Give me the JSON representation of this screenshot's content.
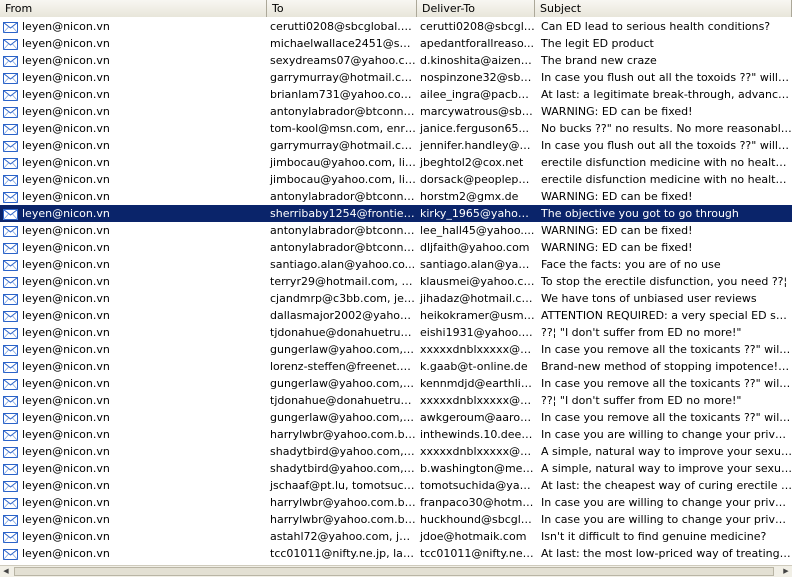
{
  "columns": {
    "from": "From",
    "to": "To",
    "deliver_to": "Deliver-To",
    "subject": "Subject"
  },
  "icon": "envelope-icon",
  "selected_index": 11,
  "rows": [
    {
      "from": "leyen@nicon.vn",
      "to": "cerutti0208@sbcglobal.ne...",
      "deliver_to": "cerutti0208@sbcglo...",
      "subject": "Can ED lead to serious health conditions?"
    },
    {
      "from": "leyen@nicon.vn",
      "to": "michaelwallace2451@sbcg...",
      "deliver_to": "apedantforallreaso...",
      "subject": "The legit ED product"
    },
    {
      "from": "leyen@nicon.vn",
      "to": "sexydreams07@yahoo.co...",
      "deliver_to": "d.kinoshita@aizene...",
      "subject": "The brand new craze"
    },
    {
      "from": "leyen@nicon.vn",
      "to": "garrymurray@hotmail.co...",
      "deliver_to": "nospinzone32@sbc...",
      "subject": "In case you flush out all the toxoids ??\" will it st..."
    },
    {
      "from": "leyen@nicon.vn",
      "to": "brianlam731@yahoo.com....",
      "deliver_to": "ailee_ingra@pacbell...",
      "subject": "At last: a legitimate break-through, advanced i..."
    },
    {
      "from": "leyen@nicon.vn",
      "to": "antonylabrador@btconne...",
      "deliver_to": "marcywatrous@sbc...",
      "subject": "WARNING: ED can be fixed!"
    },
    {
      "from": "leyen@nicon.vn",
      "to": "tom-kool@msn.com, enriq...",
      "deliver_to": "janice.ferguson65...",
      "subject": "No bucks ??\" no results. No more reasonable er..."
    },
    {
      "from": "leyen@nicon.vn",
      "to": "garrymurray@hotmail.co...",
      "deliver_to": "jennifer.handley@b...",
      "subject": "In case you flush out all the toxoids ??\" will it st..."
    },
    {
      "from": "leyen@nicon.vn",
      "to": "jimbocau@yahoo.com, lin...",
      "deliver_to": "jbeghtol2@cox.net",
      "subject": "erectile disfunction medicine with no health risks"
    },
    {
      "from": "leyen@nicon.vn",
      "to": "jimbocau@yahoo.com, lin...",
      "deliver_to": "dorsack@peoplepc....",
      "subject": "erectile disfunction medicine with no health risks"
    },
    {
      "from": "leyen@nicon.vn",
      "to": "antonylabrador@btconne...",
      "deliver_to": "horstm2@gmx.de",
      "subject": "WARNING: ED can be fixed!"
    },
    {
      "from": "leyen@nicon.vn",
      "to": "sherribaby1254@frontier...",
      "deliver_to": "kirky_1965@yahoo....",
      "subject": "The objective you got to go through"
    },
    {
      "from": "leyen@nicon.vn",
      "to": "antonylabrador@btconne...",
      "deliver_to": "lee_hall45@yahoo....",
      "subject": "WARNING: ED can be fixed!"
    },
    {
      "from": "leyen@nicon.vn",
      "to": "antonylabrador@btconne...",
      "deliver_to": "dljfaith@yahoo.com",
      "subject": "WARNING: ED can be fixed!"
    },
    {
      "from": "leyen@nicon.vn",
      "to": "santiago.alan@yahoo.co...",
      "deliver_to": "santiago.alan@yah...",
      "subject": "Face the facts: you are of no use"
    },
    {
      "from": "leyen@nicon.vn",
      "to": "terryr29@hotmail.com, kl...",
      "deliver_to": "klausmei@yahoo.com",
      "subject": "To stop the erectile disfunction, you need ??¦"
    },
    {
      "from": "leyen@nicon.vn",
      "to": "cjandmrp@c3bb.com, jery...",
      "deliver_to": "jihadaz@hotmail.com",
      "subject": "We have tons of unbiased user reviews"
    },
    {
      "from": "leyen@nicon.vn",
      "to": "dallasmajor2002@yahoo....",
      "deliver_to": "heikokramer@usmb...",
      "subject": "ATTENTION REQUIRED: a very special ED sup..."
    },
    {
      "from": "leyen@nicon.vn",
      "to": "tjdonahue@donahuetruck...",
      "deliver_to": "eishi1931@yahoo.c...",
      "subject": "??¦ \"I don't suffer from ED no more!\""
    },
    {
      "from": "leyen@nicon.vn",
      "to": "gungerlaw@yahoo.com, x...",
      "deliver_to": "xxxxxdnblxxxxx@7...",
      "subject": "In case you remove all the toxicants ??\" will it c..."
    },
    {
      "from": "leyen@nicon.vn",
      "to": "lorenz-steffen@freenet.d...",
      "deliver_to": "k.gaab@t-online.de",
      "subject": "Brand-new method of stopping impotence!! W..."
    },
    {
      "from": "leyen@nicon.vn",
      "to": "gungerlaw@yahoo.com, x...",
      "deliver_to": "kennmdjd@earthlin...",
      "subject": "In case you remove all the toxicants ??\" will it c..."
    },
    {
      "from": "leyen@nicon.vn",
      "to": "tjdonahue@donahuetruck...",
      "deliver_to": "xxxxxdnblxxxxx@2...",
      "subject": "??¦ \"I don't suffer from ED no more!\""
    },
    {
      "from": "leyen@nicon.vn",
      "to": "gungerlaw@yahoo.com, x...",
      "deliver_to": "awkgeroum@aaron...",
      "subject": "In case you remove all the toxicants ??\" will it c..."
    },
    {
      "from": "leyen@nicon.vn",
      "to": "harrylwbr@yahoo.com.br...",
      "deliver_to": "inthewinds.10.deep...",
      "subject": "In case you are willing to change your private life"
    },
    {
      "from": "leyen@nicon.vn",
      "to": "shadytbird@yahoo.com, c...",
      "deliver_to": "xxxxxdnblxxxxx@2...",
      "subject": "A simple, natural way to improve your sexual p..."
    },
    {
      "from": "leyen@nicon.vn",
      "to": "shadytbird@yahoo.com, c...",
      "deliver_to": "b.washington@mer...",
      "subject": "A simple, natural way to improve your sexual p..."
    },
    {
      "from": "leyen@nicon.vn",
      "to": "jschaaf@pt.lu, tomotsuchi...",
      "deliver_to": "tomotsuchida@yah...",
      "subject": "At last: the cheapest way of curing erectile dis..."
    },
    {
      "from": "leyen@nicon.vn",
      "to": "harrylwbr@yahoo.com.br...",
      "deliver_to": "franpaco30@hotmai...",
      "subject": "In case you are willing to change your private life"
    },
    {
      "from": "leyen@nicon.vn",
      "to": "harrylwbr@yahoo.com.br...",
      "deliver_to": "huckhound@sbcglo...",
      "subject": "In case you are willing to change your private life"
    },
    {
      "from": "leyen@nicon.vn",
      "to": "astahl72@yahoo.com, jdo...",
      "deliver_to": "jdoe@hotmaik.com",
      "subject": "Isn't it difficult to find genuine medicine?"
    },
    {
      "from": "leyen@nicon.vn",
      "to": "tcc01011@nifty.ne.jp, lab...",
      "deliver_to": "tcc01011@nifty.ne.jp",
      "subject": "At last: the most low-priced way of treating er..."
    }
  ]
}
